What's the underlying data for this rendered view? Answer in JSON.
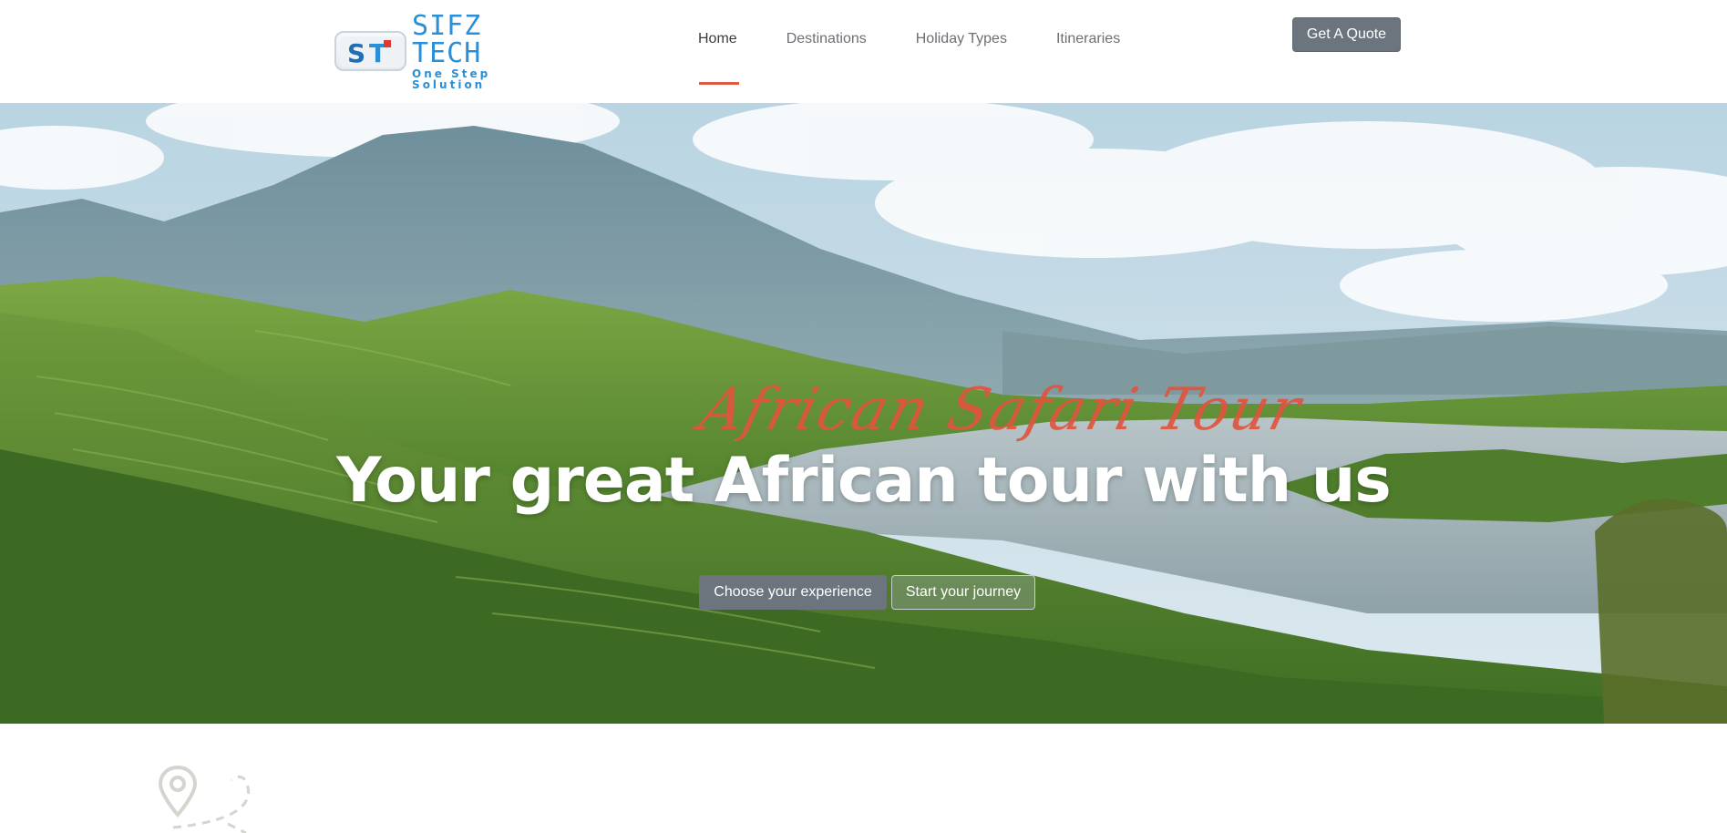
{
  "header": {
    "logo": {
      "badge_text": "ST",
      "name": "SIFZ TECH",
      "tagline": "One Step Solution"
    },
    "nav": [
      {
        "label": "Home",
        "active": true
      },
      {
        "label": "Destinations",
        "active": false
      },
      {
        "label": "Holiday Types",
        "active": false
      },
      {
        "label": "Itineraries",
        "active": false
      }
    ],
    "quote_button": "Get A Quote",
    "accent_color": "#e05a3f"
  },
  "hero": {
    "script_title": "African Safari Tour",
    "title": "Your great African tour with us",
    "primary_button": "Choose your experience",
    "secondary_button": "Start your journey",
    "background": "mountain-lake-landscape-photo"
  },
  "below_hero": {
    "icon": "map-pin-route-icon"
  }
}
